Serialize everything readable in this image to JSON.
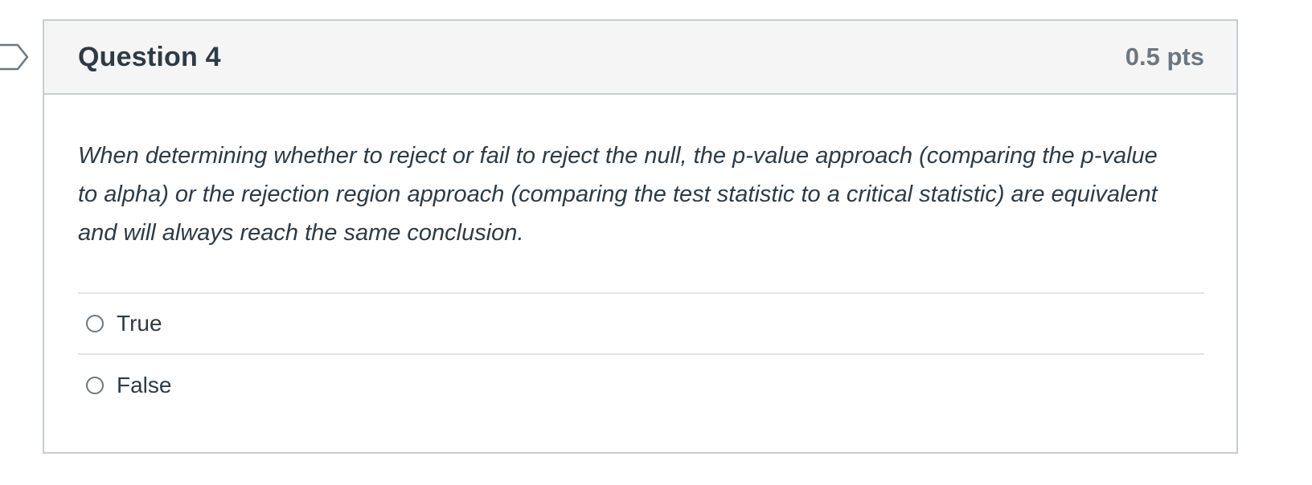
{
  "question": {
    "title": "Question 4",
    "points": "0.5 pts",
    "text": "When determining whether to reject or fail to reject the null, the p-value approach (comparing the p-value to alpha) or the rejection region approach (comparing the test statistic to a critical statistic) are equivalent and will always reach the same conclusion.",
    "answers": [
      {
        "label": "True"
      },
      {
        "label": "False"
      }
    ]
  },
  "colors": {
    "header_bg": "#f5f5f5",
    "border": "#c7cdd1",
    "text": "#2d3b45",
    "muted": "#6b7780"
  },
  "icons": {
    "flag": "bookmark-flag-icon",
    "radio": "radio-button-icon"
  }
}
